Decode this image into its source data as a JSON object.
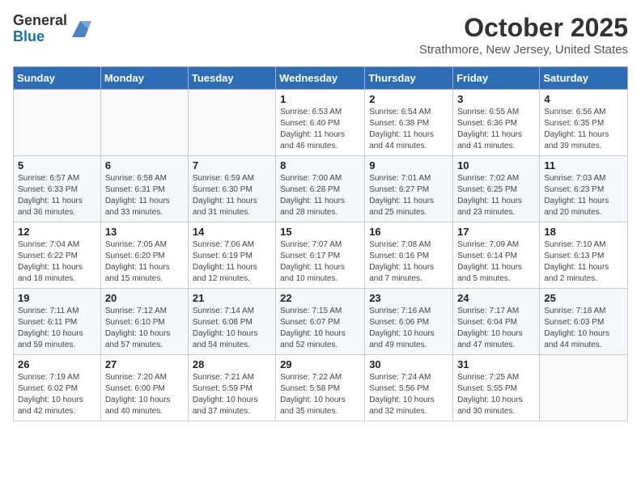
{
  "header": {
    "logo_general": "General",
    "logo_blue": "Blue",
    "month_title": "October 2025",
    "location": "Strathmore, New Jersey, United States"
  },
  "weekdays": [
    "Sunday",
    "Monday",
    "Tuesday",
    "Wednesday",
    "Thursday",
    "Friday",
    "Saturday"
  ],
  "weeks": [
    [
      {
        "day": "",
        "info": ""
      },
      {
        "day": "",
        "info": ""
      },
      {
        "day": "",
        "info": ""
      },
      {
        "day": "1",
        "info": "Sunrise: 6:53 AM\nSunset: 6:40 PM\nDaylight: 11 hours and 46 minutes."
      },
      {
        "day": "2",
        "info": "Sunrise: 6:54 AM\nSunset: 6:38 PM\nDaylight: 11 hours and 44 minutes."
      },
      {
        "day": "3",
        "info": "Sunrise: 6:55 AM\nSunset: 6:36 PM\nDaylight: 11 hours and 41 minutes."
      },
      {
        "day": "4",
        "info": "Sunrise: 6:56 AM\nSunset: 6:35 PM\nDaylight: 11 hours and 39 minutes."
      }
    ],
    [
      {
        "day": "5",
        "info": "Sunrise: 6:57 AM\nSunset: 6:33 PM\nDaylight: 11 hours and 36 minutes."
      },
      {
        "day": "6",
        "info": "Sunrise: 6:58 AM\nSunset: 6:31 PM\nDaylight: 11 hours and 33 minutes."
      },
      {
        "day": "7",
        "info": "Sunrise: 6:59 AM\nSunset: 6:30 PM\nDaylight: 11 hours and 31 minutes."
      },
      {
        "day": "8",
        "info": "Sunrise: 7:00 AM\nSunset: 6:28 PM\nDaylight: 11 hours and 28 minutes."
      },
      {
        "day": "9",
        "info": "Sunrise: 7:01 AM\nSunset: 6:27 PM\nDaylight: 11 hours and 25 minutes."
      },
      {
        "day": "10",
        "info": "Sunrise: 7:02 AM\nSunset: 6:25 PM\nDaylight: 11 hours and 23 minutes."
      },
      {
        "day": "11",
        "info": "Sunrise: 7:03 AM\nSunset: 6:23 PM\nDaylight: 11 hours and 20 minutes."
      }
    ],
    [
      {
        "day": "12",
        "info": "Sunrise: 7:04 AM\nSunset: 6:22 PM\nDaylight: 11 hours and 18 minutes."
      },
      {
        "day": "13",
        "info": "Sunrise: 7:05 AM\nSunset: 6:20 PM\nDaylight: 11 hours and 15 minutes."
      },
      {
        "day": "14",
        "info": "Sunrise: 7:06 AM\nSunset: 6:19 PM\nDaylight: 11 hours and 12 minutes."
      },
      {
        "day": "15",
        "info": "Sunrise: 7:07 AM\nSunset: 6:17 PM\nDaylight: 11 hours and 10 minutes."
      },
      {
        "day": "16",
        "info": "Sunrise: 7:08 AM\nSunset: 6:16 PM\nDaylight: 11 hours and 7 minutes."
      },
      {
        "day": "17",
        "info": "Sunrise: 7:09 AM\nSunset: 6:14 PM\nDaylight: 11 hours and 5 minutes."
      },
      {
        "day": "18",
        "info": "Sunrise: 7:10 AM\nSunset: 6:13 PM\nDaylight: 11 hours and 2 minutes."
      }
    ],
    [
      {
        "day": "19",
        "info": "Sunrise: 7:11 AM\nSunset: 6:11 PM\nDaylight: 10 hours and 59 minutes."
      },
      {
        "day": "20",
        "info": "Sunrise: 7:12 AM\nSunset: 6:10 PM\nDaylight: 10 hours and 57 minutes."
      },
      {
        "day": "21",
        "info": "Sunrise: 7:14 AM\nSunset: 6:08 PM\nDaylight: 10 hours and 54 minutes."
      },
      {
        "day": "22",
        "info": "Sunrise: 7:15 AM\nSunset: 6:07 PM\nDaylight: 10 hours and 52 minutes."
      },
      {
        "day": "23",
        "info": "Sunrise: 7:16 AM\nSunset: 6:06 PM\nDaylight: 10 hours and 49 minutes."
      },
      {
        "day": "24",
        "info": "Sunrise: 7:17 AM\nSunset: 6:04 PM\nDaylight: 10 hours and 47 minutes."
      },
      {
        "day": "25",
        "info": "Sunrise: 7:18 AM\nSunset: 6:03 PM\nDaylight: 10 hours and 44 minutes."
      }
    ],
    [
      {
        "day": "26",
        "info": "Sunrise: 7:19 AM\nSunset: 6:02 PM\nDaylight: 10 hours and 42 minutes."
      },
      {
        "day": "27",
        "info": "Sunrise: 7:20 AM\nSunset: 6:00 PM\nDaylight: 10 hours and 40 minutes."
      },
      {
        "day": "28",
        "info": "Sunrise: 7:21 AM\nSunset: 5:59 PM\nDaylight: 10 hours and 37 minutes."
      },
      {
        "day": "29",
        "info": "Sunrise: 7:22 AM\nSunset: 5:58 PM\nDaylight: 10 hours and 35 minutes."
      },
      {
        "day": "30",
        "info": "Sunrise: 7:24 AM\nSunset: 5:56 PM\nDaylight: 10 hours and 32 minutes."
      },
      {
        "day": "31",
        "info": "Sunrise: 7:25 AM\nSunset: 5:55 PM\nDaylight: 10 hours and 30 minutes."
      },
      {
        "day": "",
        "info": ""
      }
    ]
  ]
}
